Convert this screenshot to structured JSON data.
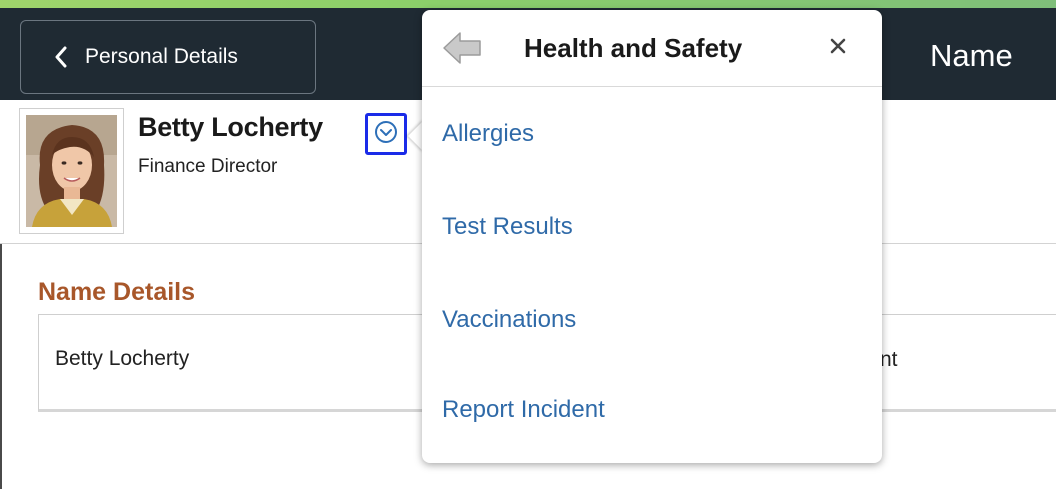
{
  "header": {
    "back_label": "Personal Details",
    "page_title": "Name"
  },
  "profile": {
    "name": "Betty Locherty",
    "title": "Finance Director"
  },
  "section": {
    "title": "Name Details",
    "name_value": "Betty Locherty",
    "partial_right_text": "nt"
  },
  "popup": {
    "title": "Health and Safety",
    "items": [
      {
        "label": "Allergies"
      },
      {
        "label": "Test Results"
      },
      {
        "label": "Vaccinations"
      },
      {
        "label": "Report Incident"
      }
    ]
  },
  "colors": {
    "header_bg": "#1f2a33",
    "link": "#2f6aa8",
    "section_title": "#a8572a",
    "highlight": "#1a2be8"
  },
  "icons": {
    "back": "chevron-left-icon",
    "popup_back": "arrow-left-icon",
    "close": "close-icon",
    "related": "chevron-down-circle-icon"
  }
}
